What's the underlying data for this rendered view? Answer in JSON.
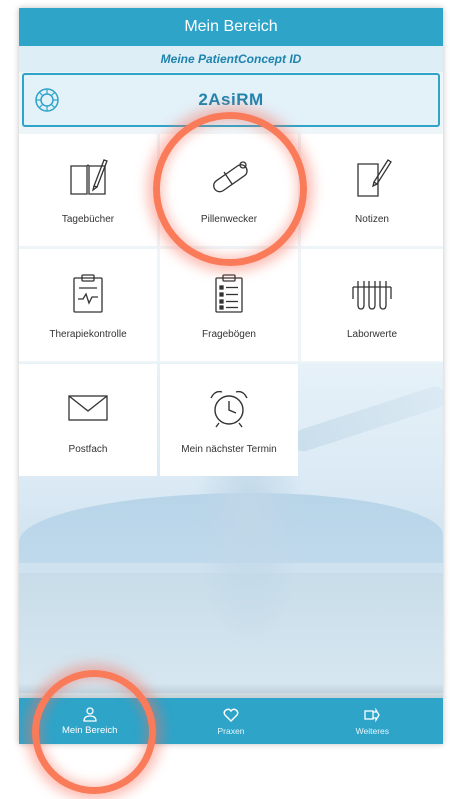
{
  "header": {
    "title": "Mein Bereich"
  },
  "subheader": {
    "title": "Meine PatientConcept ID"
  },
  "id_box": {
    "code": "2AsiRM"
  },
  "tiles": [
    {
      "label": "Tagebücher",
      "icon": "diary-icon"
    },
    {
      "label": "Pillenwecker",
      "icon": "pill-icon"
    },
    {
      "label": "Notizen",
      "icon": "note-icon"
    },
    {
      "label": "Therapiekontrolle",
      "icon": "clipboard-chart-icon"
    },
    {
      "label": "Fragebögen",
      "icon": "questionnaire-icon"
    },
    {
      "label": "Laborwerte",
      "icon": "test-tubes-icon"
    },
    {
      "label": "Postfach",
      "icon": "mail-icon"
    },
    {
      "label": "Mein nächster Termin",
      "icon": "alarm-clock-icon"
    }
  ],
  "tabbar": {
    "items": [
      {
        "label": "Mein Bereich",
        "icon": "person-icon",
        "active": true
      },
      {
        "label": "Praxen",
        "icon": "heart-icon",
        "active": false
      },
      {
        "label": "Weiteres",
        "icon": "more-arrow-icon",
        "active": false
      }
    ]
  },
  "colors": {
    "primary": "#2ea4c9",
    "highlight_circle": "#fa7b5a"
  }
}
